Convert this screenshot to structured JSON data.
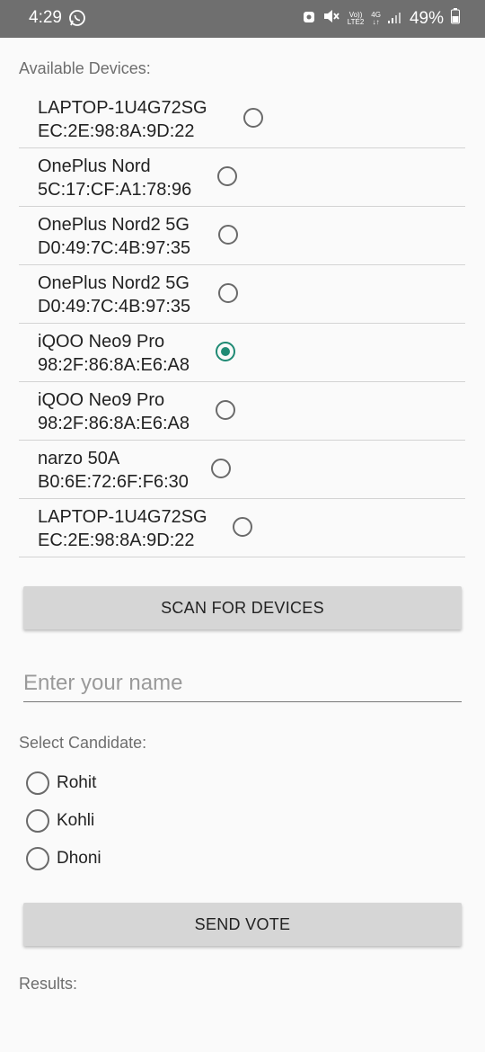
{
  "status_bar": {
    "time": "4:29",
    "volte_top": "Vo))",
    "volte_bottom": "LTE2",
    "net_top": "4G",
    "net_bottom": "↓↑",
    "battery": "49%"
  },
  "devices_label": "Available Devices:",
  "devices": [
    {
      "name": "LAPTOP-1U4G72SG",
      "mac": "EC:2E:98:8A:9D:22",
      "selected": false
    },
    {
      "name": "OnePlus Nord",
      "mac": "5C:17:CF:A1:78:96",
      "selected": false
    },
    {
      "name": "OnePlus Nord2 5G",
      "mac": "D0:49:7C:4B:97:35",
      "selected": false
    },
    {
      "name": "OnePlus Nord2 5G",
      "mac": "D0:49:7C:4B:97:35",
      "selected": false
    },
    {
      "name": "iQOO Neo9 Pro",
      "mac": "98:2F:86:8A:E6:A8",
      "selected": true
    },
    {
      "name": "iQOO Neo9 Pro",
      "mac": "98:2F:86:8A:E6:A8",
      "selected": false
    },
    {
      "name": "narzo 50A",
      "mac": "B0:6E:72:6F:F6:30",
      "selected": false
    },
    {
      "name": "LAPTOP-1U4G72SG",
      "mac": "EC:2E:98:8A:9D:22",
      "selected": false
    }
  ],
  "scan_button": "SCAN FOR DEVICES",
  "name_input": {
    "placeholder": "Enter your name",
    "value": ""
  },
  "candidate_label": "Select Candidate:",
  "candidates": [
    "Rohit",
    "Kohli",
    "Dhoni"
  ],
  "send_button": "SEND VOTE",
  "results_label": "Results:",
  "colors": {
    "accent": "#1f8a74",
    "statusbar": "#6f6f6f",
    "button": "#d6d6d6"
  }
}
